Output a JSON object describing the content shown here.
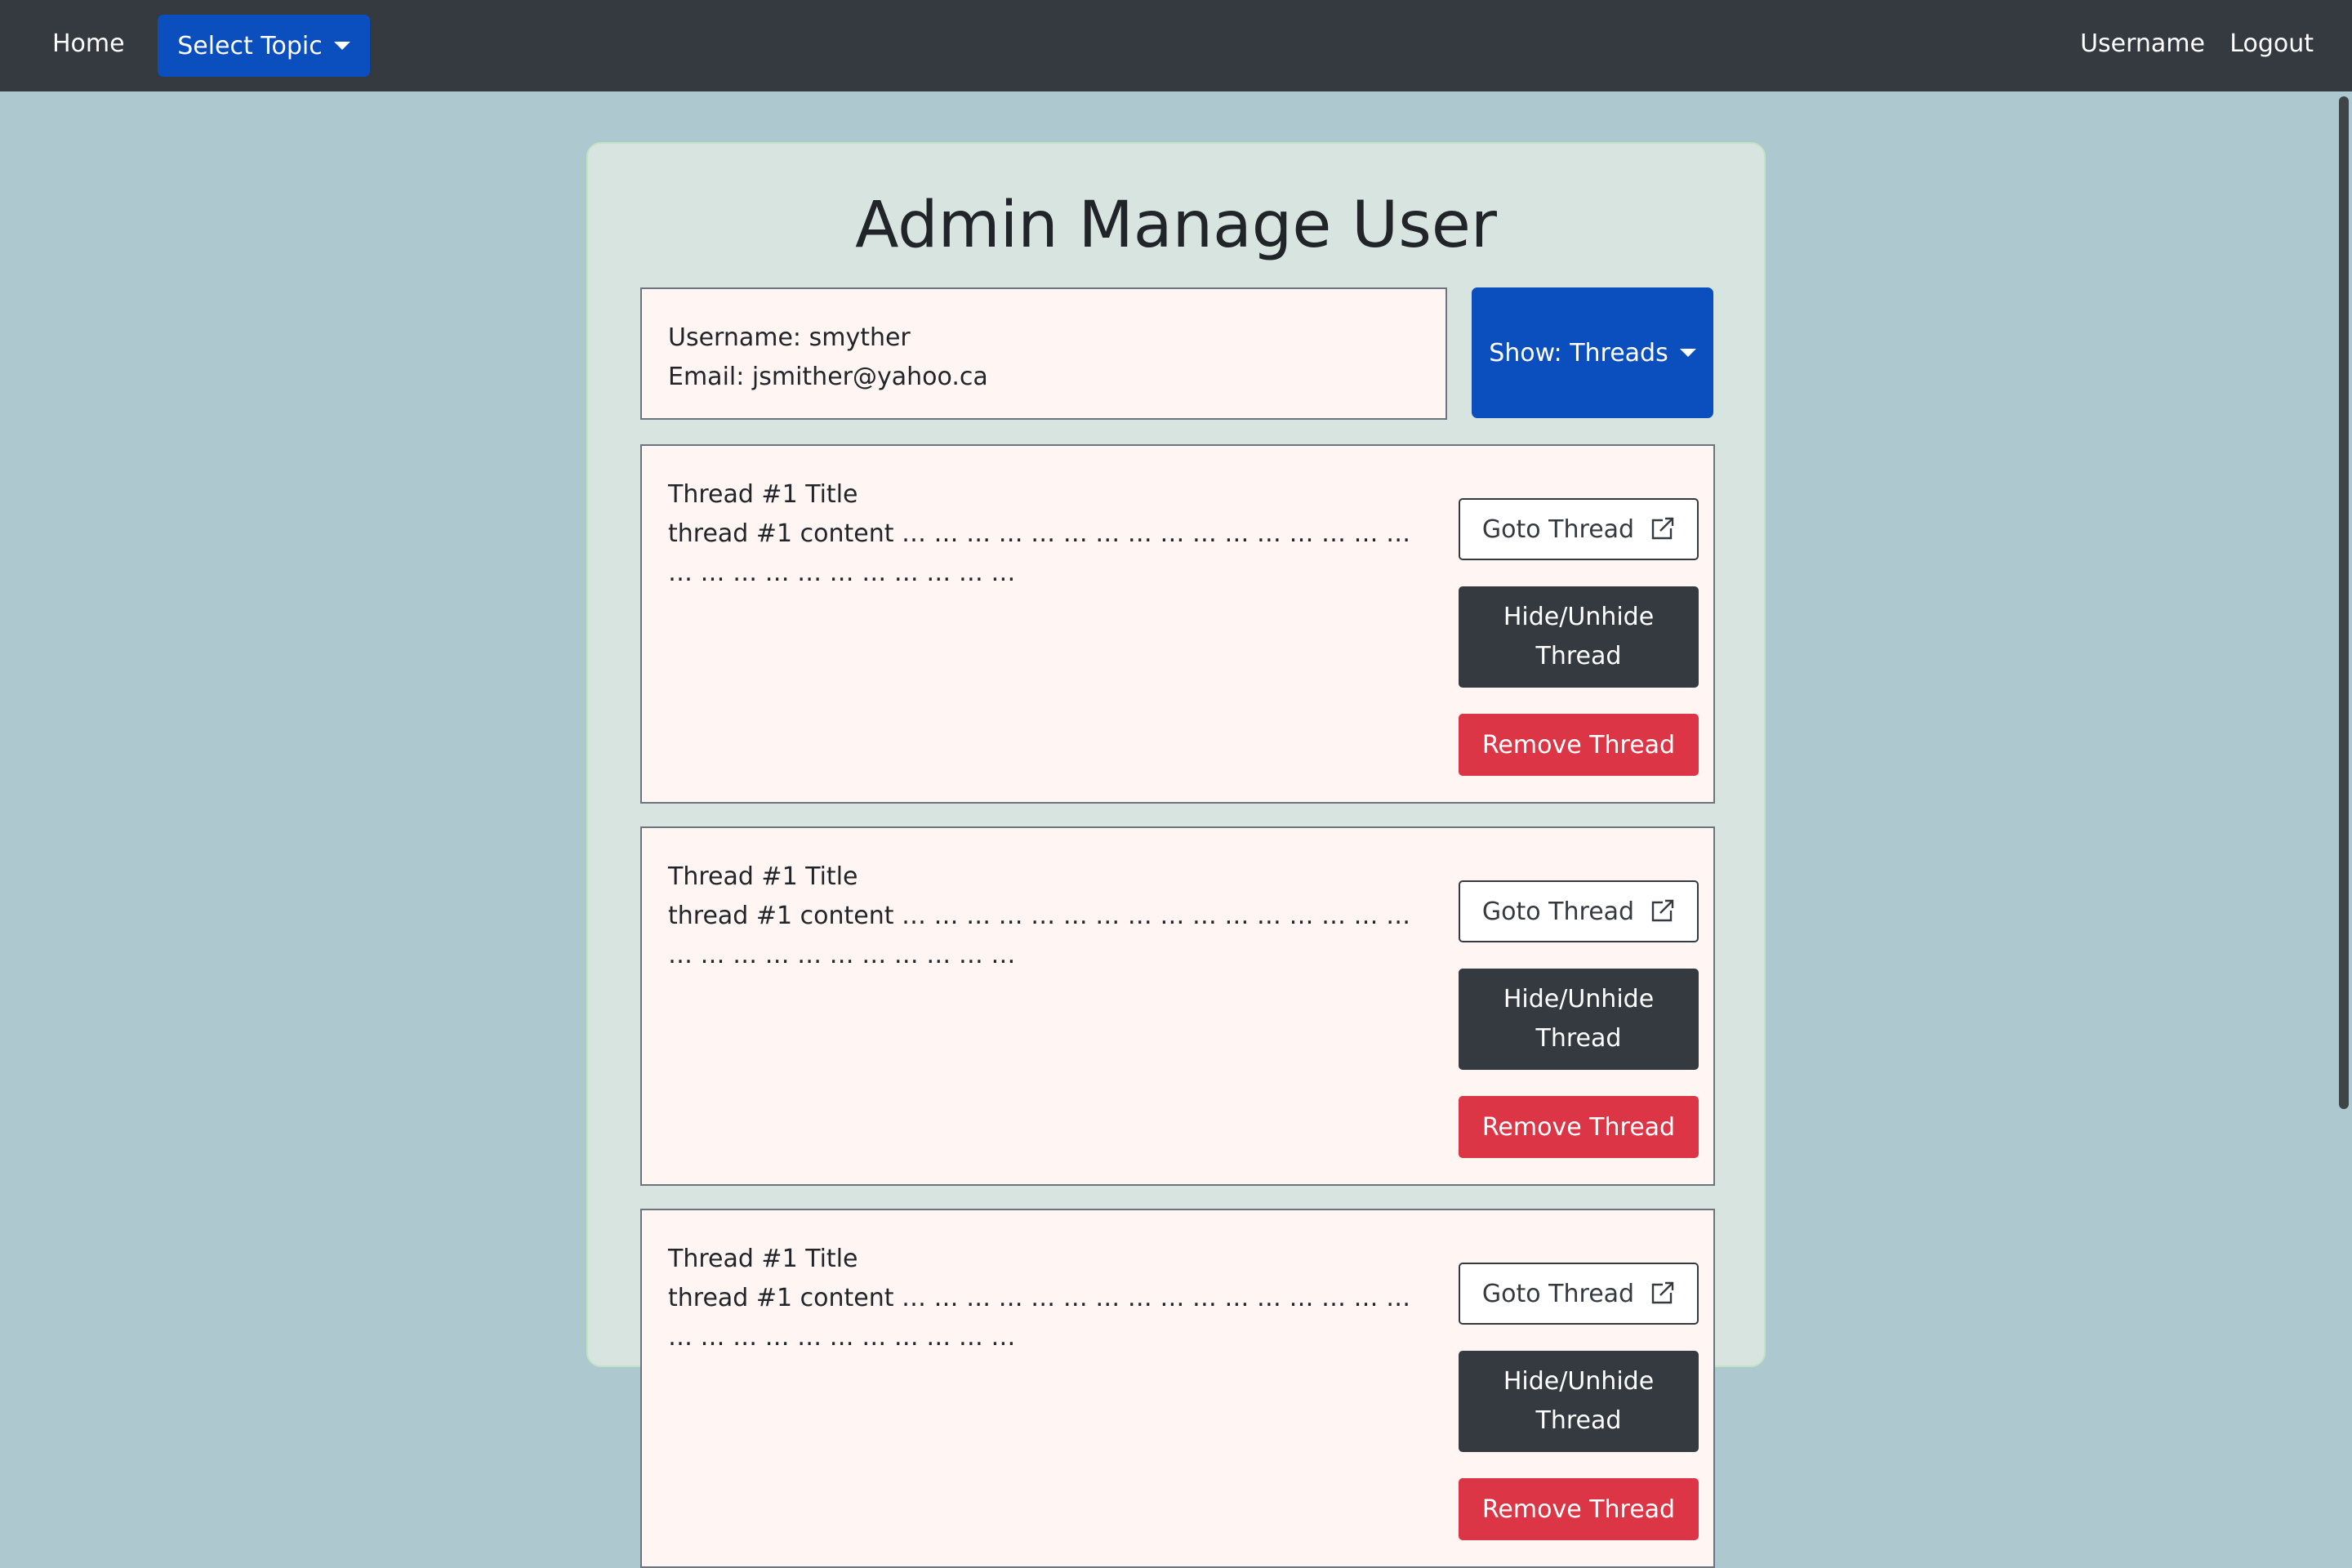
{
  "navbar": {
    "home_label": "Home",
    "topic_label": "Select Topic",
    "username_label": "Username",
    "logout_label": "Logout"
  },
  "page": {
    "title": "Admin Manage User"
  },
  "user": {
    "username_label": "Username:",
    "username": "smyther",
    "email_label": "Email:",
    "email": "jsmither@yahoo.ca"
  },
  "filter": {
    "label": "Show: Threads"
  },
  "threads": [
    {
      "title": "Thread #1 Title",
      "content": "thread #1 content … … … … … … … … … … … … … … … … … … … … … … … … … … …",
      "goto_label": "Goto Thread",
      "hide_label": "Hide/Unhide Thread",
      "remove_label": "Remove Thread"
    },
    {
      "title": "Thread #1 Title",
      "content": "thread #1 content … … … … … … … … … … … … … … … … … … … … … … … … … … …",
      "goto_label": "Goto Thread",
      "hide_label": "Hide/Unhide Thread",
      "remove_label": "Remove Thread"
    },
    {
      "title": "Thread #1 Title",
      "content": "thread #1 content … … … … … … … … … … … … … … … … … … … … … … … … … … …",
      "goto_label": "Goto Thread",
      "hide_label": "Hide/Unhide Thread",
      "remove_label": "Remove Thread"
    }
  ],
  "icons": {
    "goto": "external-link-icon",
    "dropdown": "caret-down-icon"
  },
  "colors": {
    "navbar": "#343a40",
    "primary": "#0b4ebd",
    "danger": "#dc3545",
    "background": "#adc8cf",
    "panel": "#d7e4df",
    "card": "#fff5f3"
  }
}
